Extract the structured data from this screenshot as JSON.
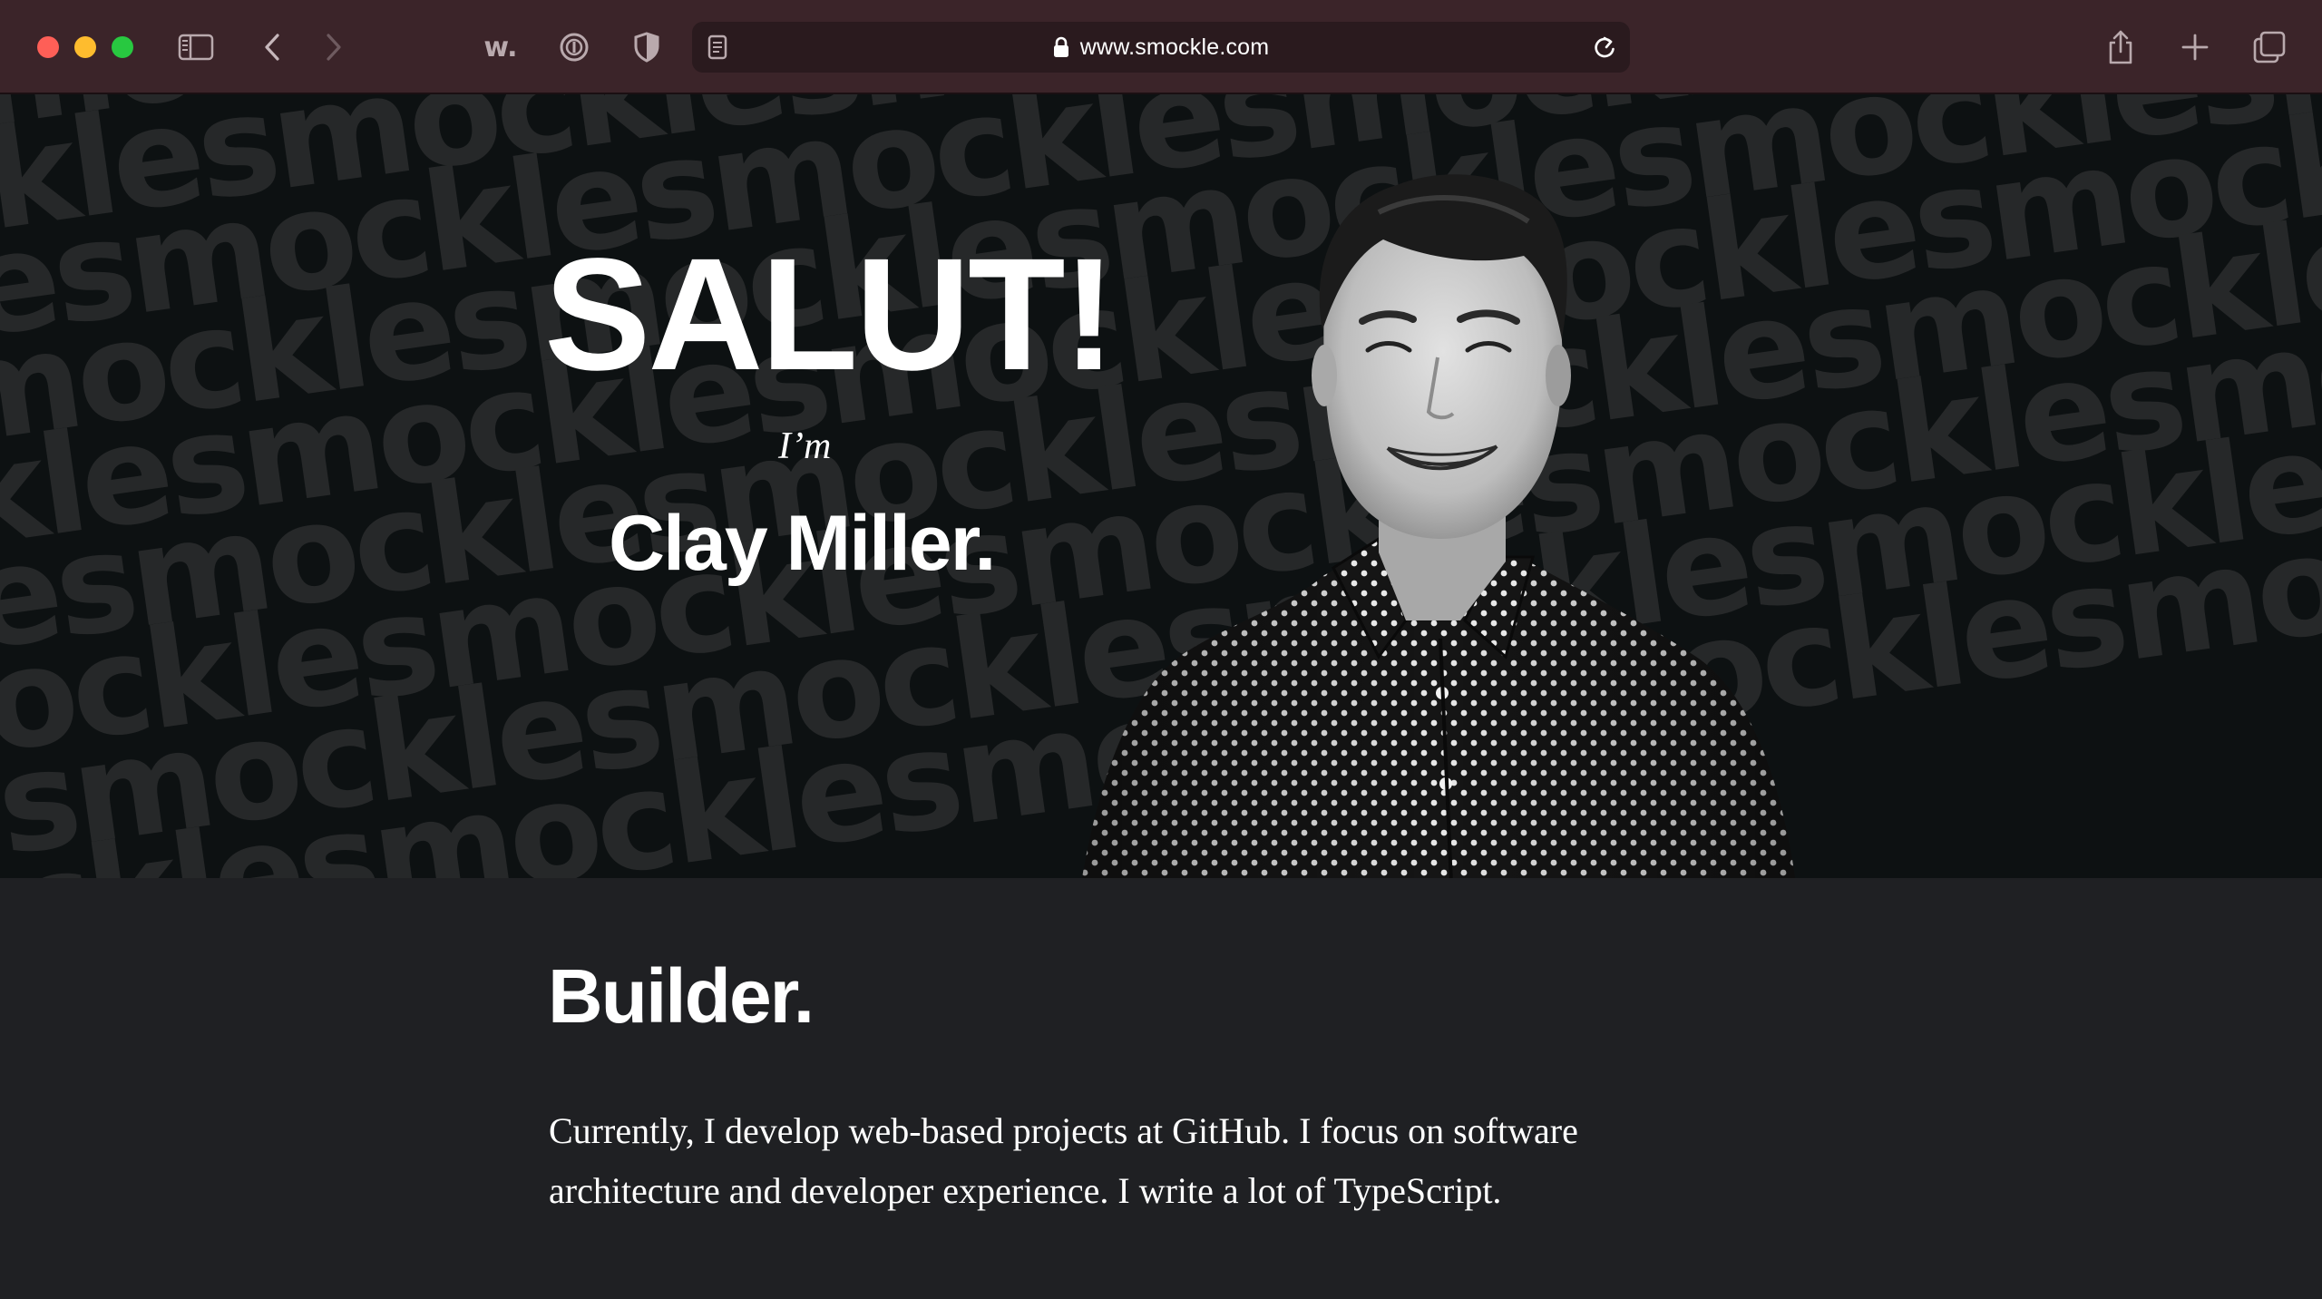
{
  "browser": {
    "url": "www.smockle.com",
    "extension_badge": "w.",
    "icons": {
      "sidebar": "sidebar-icon",
      "back": "chevron-left-icon",
      "forward": "chevron-right-icon",
      "password": "password-icon",
      "shield": "shield-icon",
      "reader": "reader-icon",
      "lock": "lock-icon",
      "reload": "reload-icon",
      "share": "share-icon",
      "new_tab": "plus-icon",
      "tabs": "tabs-overview-icon"
    }
  },
  "hero": {
    "greeting": "SALUT!",
    "intro": "I’m",
    "name": "Clay Miller.",
    "background_word": "smockle"
  },
  "content": {
    "heading": "Builder.",
    "paragraph": "Currently, I develop web-based projects at GitHub. I focus on software architecture and developer experience. I write a lot of TypeScript."
  },
  "colors": {
    "chrome": "#3b2429",
    "urlbar": "#2a1a1e",
    "hero_bg": "#0d1112",
    "pattern_text": "#262829",
    "content_bg": "#1f2023",
    "text": "#ffffff"
  }
}
